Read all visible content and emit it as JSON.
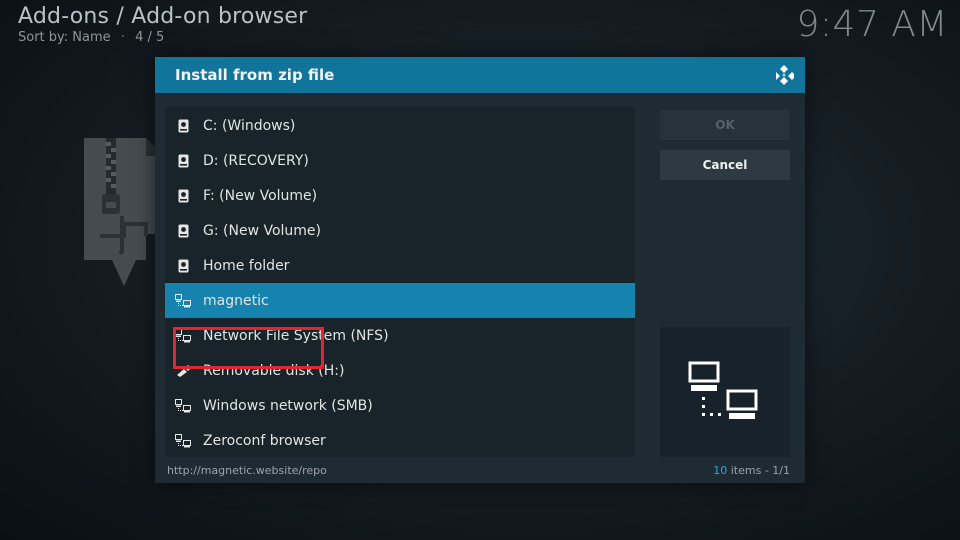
{
  "header": {
    "title": "Add-ons / Add-on browser",
    "sort_label": "Sort by: Name",
    "position": "4 / 5"
  },
  "clock": "9:47 AM",
  "dialog": {
    "title": "Install from zip file",
    "buttons": {
      "ok": "OK",
      "cancel": "Cancel"
    },
    "items": [
      {
        "label": "C: (Windows)",
        "icon": "hard-drive-icon"
      },
      {
        "label": "D: (RECOVERY)",
        "icon": "hard-drive-icon"
      },
      {
        "label": "F: (New Volume)",
        "icon": "hard-drive-icon"
      },
      {
        "label": "G: (New Volume)",
        "icon": "hard-drive-icon"
      },
      {
        "label": "Home folder",
        "icon": "hard-drive-icon"
      },
      {
        "label": "magnetic",
        "icon": "network-icon",
        "selected": true
      },
      {
        "label": "Network File System (NFS)",
        "icon": "network-icon"
      },
      {
        "label": "Removable disk (H:)",
        "icon": "usb-icon"
      },
      {
        "label": "Windows network (SMB)",
        "icon": "network-icon"
      },
      {
        "label": "Zeroconf browser",
        "icon": "network-icon"
      }
    ],
    "footer": {
      "path": "http://magnetic.website/repo",
      "count_number": "10",
      "count_suffix": " items - 1/1"
    }
  },
  "colors": {
    "header_bar": "#11749a",
    "selected_row": "#1583ae",
    "highlight_border": "#e0262e",
    "count_accent": "#2aa8d9"
  }
}
